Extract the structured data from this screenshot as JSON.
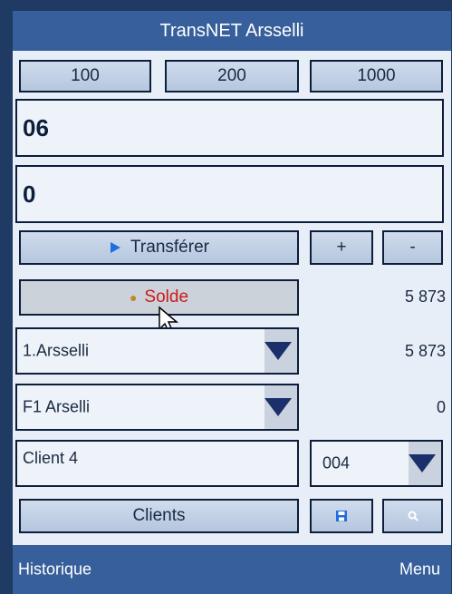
{
  "title": "TransNET Arsselli",
  "amount_buttons": [
    "100",
    "200",
    "1000"
  ],
  "number_field": "06",
  "amount_field": "0",
  "transfer": {
    "label": "Transférer",
    "icon": "play-icon"
  },
  "plus_label": "+",
  "minus_label": "-",
  "balance": {
    "label": "Solde",
    "label_color": "#cc1a1a",
    "icon": "money-bag-icon",
    "value": "5 873"
  },
  "account_select": {
    "value": "1.Arsselli",
    "balance": "5 873"
  },
  "sub_account_select": {
    "value": "F1 Arselli",
    "balance": "0"
  },
  "client_field": "Client 4",
  "client_code_select": "004",
  "clients_button": "Clients",
  "save_icon": "save-icon",
  "search_icon": "search-icon",
  "bottom": {
    "left": "Historique",
    "right": "Menu"
  },
  "colors": {
    "titlebar": "#365f9b",
    "frame": "#1f3a63",
    "button": "#c3d1e6"
  }
}
